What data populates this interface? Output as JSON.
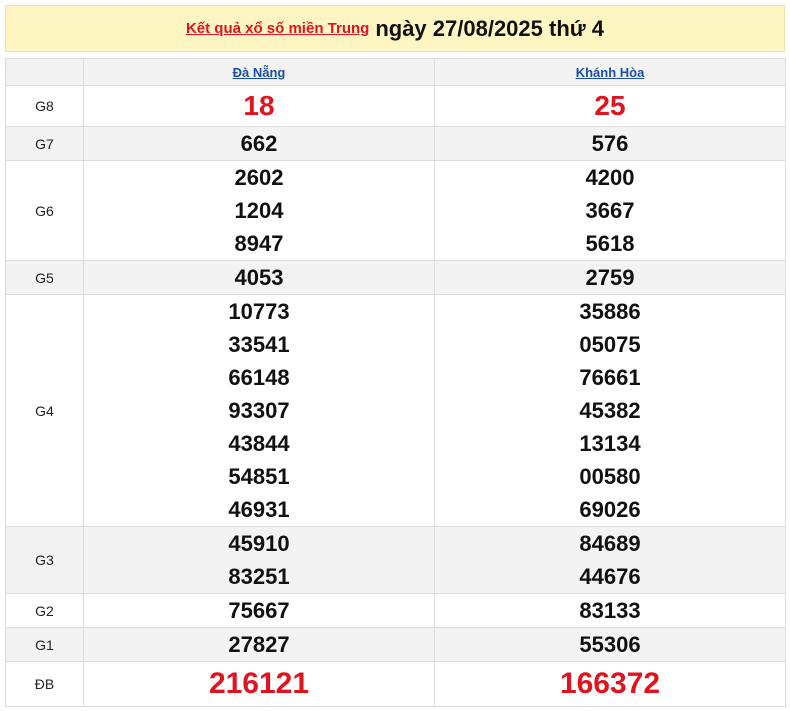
{
  "header": {
    "link_text": "Kết quả xổ số miền Trung",
    "date_text": "ngày 27/08/2025 thứ 4"
  },
  "provinces": [
    "Đà Nẵng",
    "Khánh Hòa"
  ],
  "prizes": {
    "g8": {
      "label": "G8",
      "values": [
        [
          "18"
        ],
        [
          "25"
        ]
      ]
    },
    "g7": {
      "label": "G7",
      "values": [
        [
          "662"
        ],
        [
          "576"
        ]
      ]
    },
    "g6": {
      "label": "G6",
      "values": [
        [
          "2602",
          "1204",
          "8947"
        ],
        [
          "4200",
          "3667",
          "5618"
        ]
      ]
    },
    "g5": {
      "label": "G5",
      "values": [
        [
          "4053"
        ],
        [
          "2759"
        ]
      ]
    },
    "g4": {
      "label": "G4",
      "values": [
        [
          "10773",
          "33541",
          "66148",
          "93307",
          "43844",
          "54851",
          "46931"
        ],
        [
          "35886",
          "05075",
          "76661",
          "45382",
          "13134",
          "00580",
          "69026"
        ]
      ]
    },
    "g3": {
      "label": "G3",
      "values": [
        [
          "45910",
          "83251"
        ],
        [
          "84689",
          "44676"
        ]
      ]
    },
    "g2": {
      "label": "G2",
      "values": [
        [
          "75667"
        ],
        [
          "83133"
        ]
      ]
    },
    "g1": {
      "label": "G1",
      "values": [
        [
          "27827"
        ],
        [
          "55306"
        ]
      ]
    },
    "db": {
      "label": "ĐB",
      "values": [
        [
          "216121"
        ],
        [
          "166372"
        ]
      ]
    }
  },
  "colors": {
    "header_bg": "#fdf6c3",
    "accent_red": "#e0141e",
    "link_blue": "#1a4fa8",
    "shade_row": "#f3f3f3"
  }
}
